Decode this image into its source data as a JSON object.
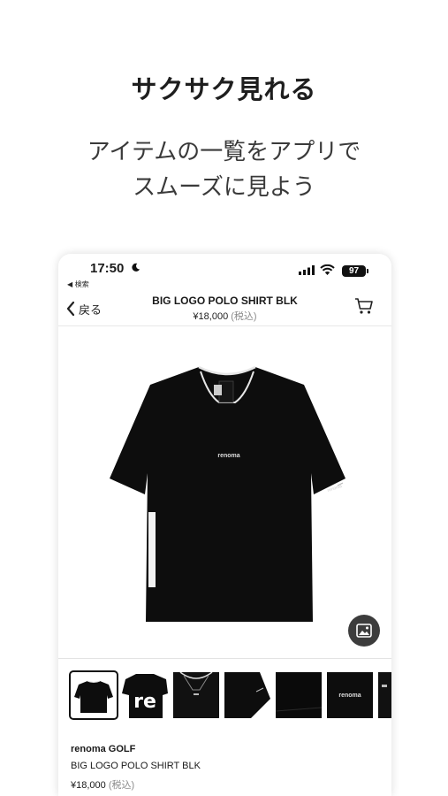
{
  "promo": {
    "heading": "サクサク見れる",
    "sub_line1": "アイテムの一覧をアプリで",
    "sub_line2": "スムーズに見よう"
  },
  "status_bar": {
    "time": "17:50",
    "back_app": "◀ 検索",
    "battery": "97"
  },
  "nav": {
    "back_label": "戻る",
    "title": "BIG LOGO POLO SHIRT BLK",
    "price": "¥18,000",
    "tax": "(税込)"
  },
  "product": {
    "shirt_logo": "renoma",
    "brand": "renoma GOLF",
    "name": "BIG LOGO POLO SHIRT BLK",
    "price": "¥18,000",
    "tax": "(税込)"
  },
  "thumbnails": {
    "thumb2_text": "re",
    "thumb6_text": "renoma"
  },
  "colors": {
    "accent": "#111111",
    "tax_gray": "#8a8a8a"
  }
}
